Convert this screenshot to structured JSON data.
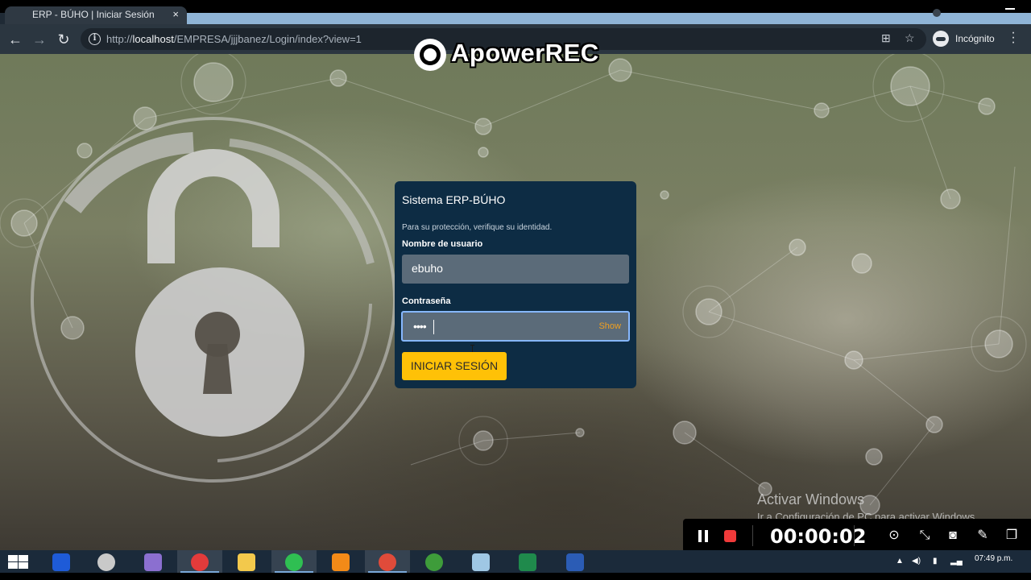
{
  "browser": {
    "tab_title": "ERP - BÚHO | Iniciar Sesión",
    "tab_close": "×",
    "url_prefix": "http://",
    "url_host": "localhost",
    "url_path": "/EMPRESA/jjjbanez/Login/index?view=1",
    "incognito_label": "Incógnito"
  },
  "watermark": {
    "text": "ApowerREC"
  },
  "login": {
    "title": "Sistema ERP-BÚHO",
    "subtitle": "Para su protección, verifique su identidad.",
    "username_label": "Nombre de usuario",
    "username_value": "ebuho",
    "password_label": "Contraseña",
    "password_mask": "••••",
    "show_label": "Show",
    "submit_label": "INICIAR SESIÓN",
    "colors": {
      "card": "#0d2c44",
      "button": "#ffc107",
      "show": "#f0a020",
      "focus_border": "#86b7fe"
    }
  },
  "windows_notice": {
    "title": "Activar Windows",
    "subtitle": "Ir a Configuración de PC para activar Windows."
  },
  "recorder": {
    "timer": "00:00:02",
    "icons": [
      "pause-icon",
      "stop-icon",
      "screenshot-region-icon",
      "shrink-icon",
      "camera-icon",
      "pen-icon",
      "window-icon"
    ]
  },
  "taskbar": {
    "apps": [
      "file-manager",
      "media",
      "app-purple",
      "screen-recorder",
      "file-explorer",
      "whatsapp",
      "sublime-text",
      "chrome",
      "hs-app",
      "notes",
      "excel",
      "word"
    ],
    "clock": "07:49 p.m."
  }
}
